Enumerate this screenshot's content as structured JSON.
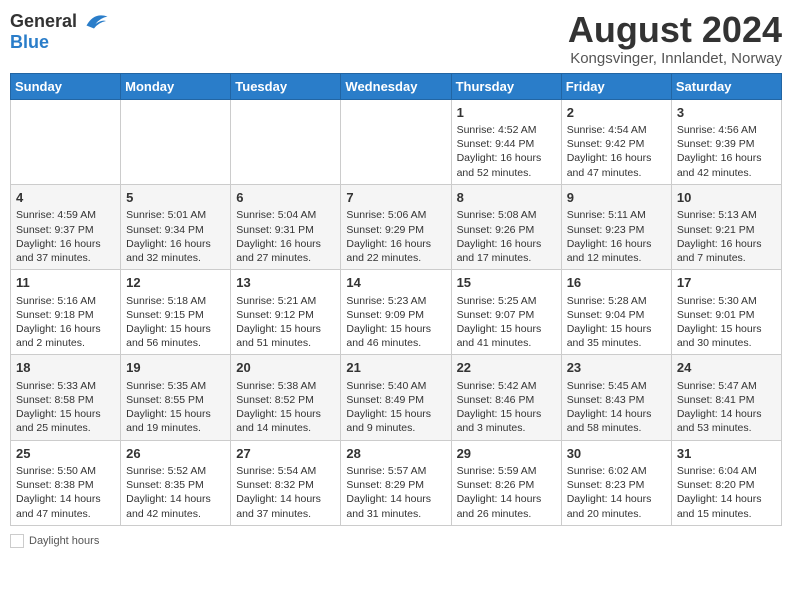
{
  "header": {
    "logo_general": "General",
    "logo_blue": "Blue",
    "month_title": "August 2024",
    "subtitle": "Kongsvinger, Innlandet, Norway"
  },
  "days_of_week": [
    "Sunday",
    "Monday",
    "Tuesday",
    "Wednesday",
    "Thursday",
    "Friday",
    "Saturday"
  ],
  "weeks": [
    [
      {
        "day": "",
        "info": ""
      },
      {
        "day": "",
        "info": ""
      },
      {
        "day": "",
        "info": ""
      },
      {
        "day": "",
        "info": ""
      },
      {
        "day": "1",
        "info": "Sunrise: 4:52 AM\nSunset: 9:44 PM\nDaylight: 16 hours\nand 52 minutes."
      },
      {
        "day": "2",
        "info": "Sunrise: 4:54 AM\nSunset: 9:42 PM\nDaylight: 16 hours\nand 47 minutes."
      },
      {
        "day": "3",
        "info": "Sunrise: 4:56 AM\nSunset: 9:39 PM\nDaylight: 16 hours\nand 42 minutes."
      }
    ],
    [
      {
        "day": "4",
        "info": "Sunrise: 4:59 AM\nSunset: 9:37 PM\nDaylight: 16 hours\nand 37 minutes."
      },
      {
        "day": "5",
        "info": "Sunrise: 5:01 AM\nSunset: 9:34 PM\nDaylight: 16 hours\nand 32 minutes."
      },
      {
        "day": "6",
        "info": "Sunrise: 5:04 AM\nSunset: 9:31 PM\nDaylight: 16 hours\nand 27 minutes."
      },
      {
        "day": "7",
        "info": "Sunrise: 5:06 AM\nSunset: 9:29 PM\nDaylight: 16 hours\nand 22 minutes."
      },
      {
        "day": "8",
        "info": "Sunrise: 5:08 AM\nSunset: 9:26 PM\nDaylight: 16 hours\nand 17 minutes."
      },
      {
        "day": "9",
        "info": "Sunrise: 5:11 AM\nSunset: 9:23 PM\nDaylight: 16 hours\nand 12 minutes."
      },
      {
        "day": "10",
        "info": "Sunrise: 5:13 AM\nSunset: 9:21 PM\nDaylight: 16 hours\nand 7 minutes."
      }
    ],
    [
      {
        "day": "11",
        "info": "Sunrise: 5:16 AM\nSunset: 9:18 PM\nDaylight: 16 hours\nand 2 minutes."
      },
      {
        "day": "12",
        "info": "Sunrise: 5:18 AM\nSunset: 9:15 PM\nDaylight: 15 hours\nand 56 minutes."
      },
      {
        "day": "13",
        "info": "Sunrise: 5:21 AM\nSunset: 9:12 PM\nDaylight: 15 hours\nand 51 minutes."
      },
      {
        "day": "14",
        "info": "Sunrise: 5:23 AM\nSunset: 9:09 PM\nDaylight: 15 hours\nand 46 minutes."
      },
      {
        "day": "15",
        "info": "Sunrise: 5:25 AM\nSunset: 9:07 PM\nDaylight: 15 hours\nand 41 minutes."
      },
      {
        "day": "16",
        "info": "Sunrise: 5:28 AM\nSunset: 9:04 PM\nDaylight: 15 hours\nand 35 minutes."
      },
      {
        "day": "17",
        "info": "Sunrise: 5:30 AM\nSunset: 9:01 PM\nDaylight: 15 hours\nand 30 minutes."
      }
    ],
    [
      {
        "day": "18",
        "info": "Sunrise: 5:33 AM\nSunset: 8:58 PM\nDaylight: 15 hours\nand 25 minutes."
      },
      {
        "day": "19",
        "info": "Sunrise: 5:35 AM\nSunset: 8:55 PM\nDaylight: 15 hours\nand 19 minutes."
      },
      {
        "day": "20",
        "info": "Sunrise: 5:38 AM\nSunset: 8:52 PM\nDaylight: 15 hours\nand 14 minutes."
      },
      {
        "day": "21",
        "info": "Sunrise: 5:40 AM\nSunset: 8:49 PM\nDaylight: 15 hours\nand 9 minutes."
      },
      {
        "day": "22",
        "info": "Sunrise: 5:42 AM\nSunset: 8:46 PM\nDaylight: 15 hours\nand 3 minutes."
      },
      {
        "day": "23",
        "info": "Sunrise: 5:45 AM\nSunset: 8:43 PM\nDaylight: 14 hours\nand 58 minutes."
      },
      {
        "day": "24",
        "info": "Sunrise: 5:47 AM\nSunset: 8:41 PM\nDaylight: 14 hours\nand 53 minutes."
      }
    ],
    [
      {
        "day": "25",
        "info": "Sunrise: 5:50 AM\nSunset: 8:38 PM\nDaylight: 14 hours\nand 47 minutes."
      },
      {
        "day": "26",
        "info": "Sunrise: 5:52 AM\nSunset: 8:35 PM\nDaylight: 14 hours\nand 42 minutes."
      },
      {
        "day": "27",
        "info": "Sunrise: 5:54 AM\nSunset: 8:32 PM\nDaylight: 14 hours\nand 37 minutes."
      },
      {
        "day": "28",
        "info": "Sunrise: 5:57 AM\nSunset: 8:29 PM\nDaylight: 14 hours\nand 31 minutes."
      },
      {
        "day": "29",
        "info": "Sunrise: 5:59 AM\nSunset: 8:26 PM\nDaylight: 14 hours\nand 26 minutes."
      },
      {
        "day": "30",
        "info": "Sunrise: 6:02 AM\nSunset: 8:23 PM\nDaylight: 14 hours\nand 20 minutes."
      },
      {
        "day": "31",
        "info": "Sunrise: 6:04 AM\nSunset: 8:20 PM\nDaylight: 14 hours\nand 15 minutes."
      }
    ]
  ],
  "footer": {
    "daylight_label": "Daylight hours"
  }
}
